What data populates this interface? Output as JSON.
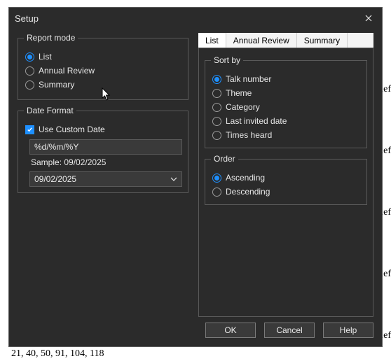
{
  "dialog": {
    "title": "Setup"
  },
  "report_mode": {
    "legend": "Report mode",
    "options": {
      "list": "List",
      "annual_review": "Annual Review",
      "summary": "Summary"
    },
    "selected": "list"
  },
  "date_format": {
    "legend": "Date Format",
    "use_custom": {
      "label": "Use Custom Date",
      "checked": true
    },
    "pattern": "%d/%m/%Y",
    "sample_label": "Sample: 09/02/2025",
    "date_value": "09/02/2025"
  },
  "tabs": {
    "list": "List",
    "annual_review": "Annual Review",
    "summary": "Summary",
    "active": "list"
  },
  "sort_by": {
    "legend": "Sort by",
    "options": {
      "talk_number": "Talk number",
      "theme": "Theme",
      "category": "Category",
      "last_invited": "Last invited date",
      "times_heard": "Times heard"
    },
    "selected": "talk_number"
  },
  "order": {
    "legend": "Order",
    "options": {
      "asc": "Ascending",
      "desc": "Descending"
    },
    "selected": "asc"
  },
  "buttons": {
    "ok": "OK",
    "cancel": "Cancel",
    "help": "Help"
  },
  "background": {
    "bottom_text": "21, 40, 50, 91, 104, 118",
    "right_fragments": [
      "lef",
      "lef",
      "lef",
      "lef",
      "lef"
    ]
  }
}
